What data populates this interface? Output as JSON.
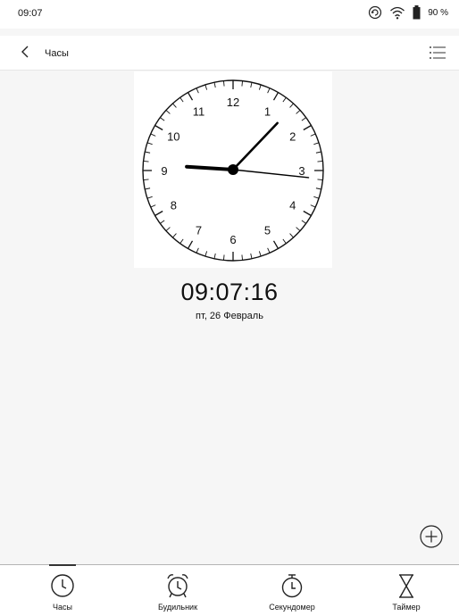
{
  "status": {
    "time": "09:07",
    "battery": "90 %"
  },
  "header": {
    "title": "Часы"
  },
  "clock": {
    "numbers": [
      "12",
      "1",
      "2",
      "3",
      "4",
      "5",
      "6",
      "7",
      "8",
      "9",
      "10",
      "11"
    ],
    "hour": 9,
    "minute": 7,
    "second": 16
  },
  "digital": {
    "time": "09:07:16",
    "date": "пт, 26 Февраль"
  },
  "nav": {
    "items": [
      {
        "label": "Часы",
        "icon": "clock-icon",
        "active": true
      },
      {
        "label": "Будильник",
        "icon": "alarm-icon",
        "active": false
      },
      {
        "label": "Секундомер",
        "icon": "stopwatch-icon",
        "active": false
      },
      {
        "label": "Таймер",
        "icon": "hourglass-icon",
        "active": false
      }
    ]
  }
}
